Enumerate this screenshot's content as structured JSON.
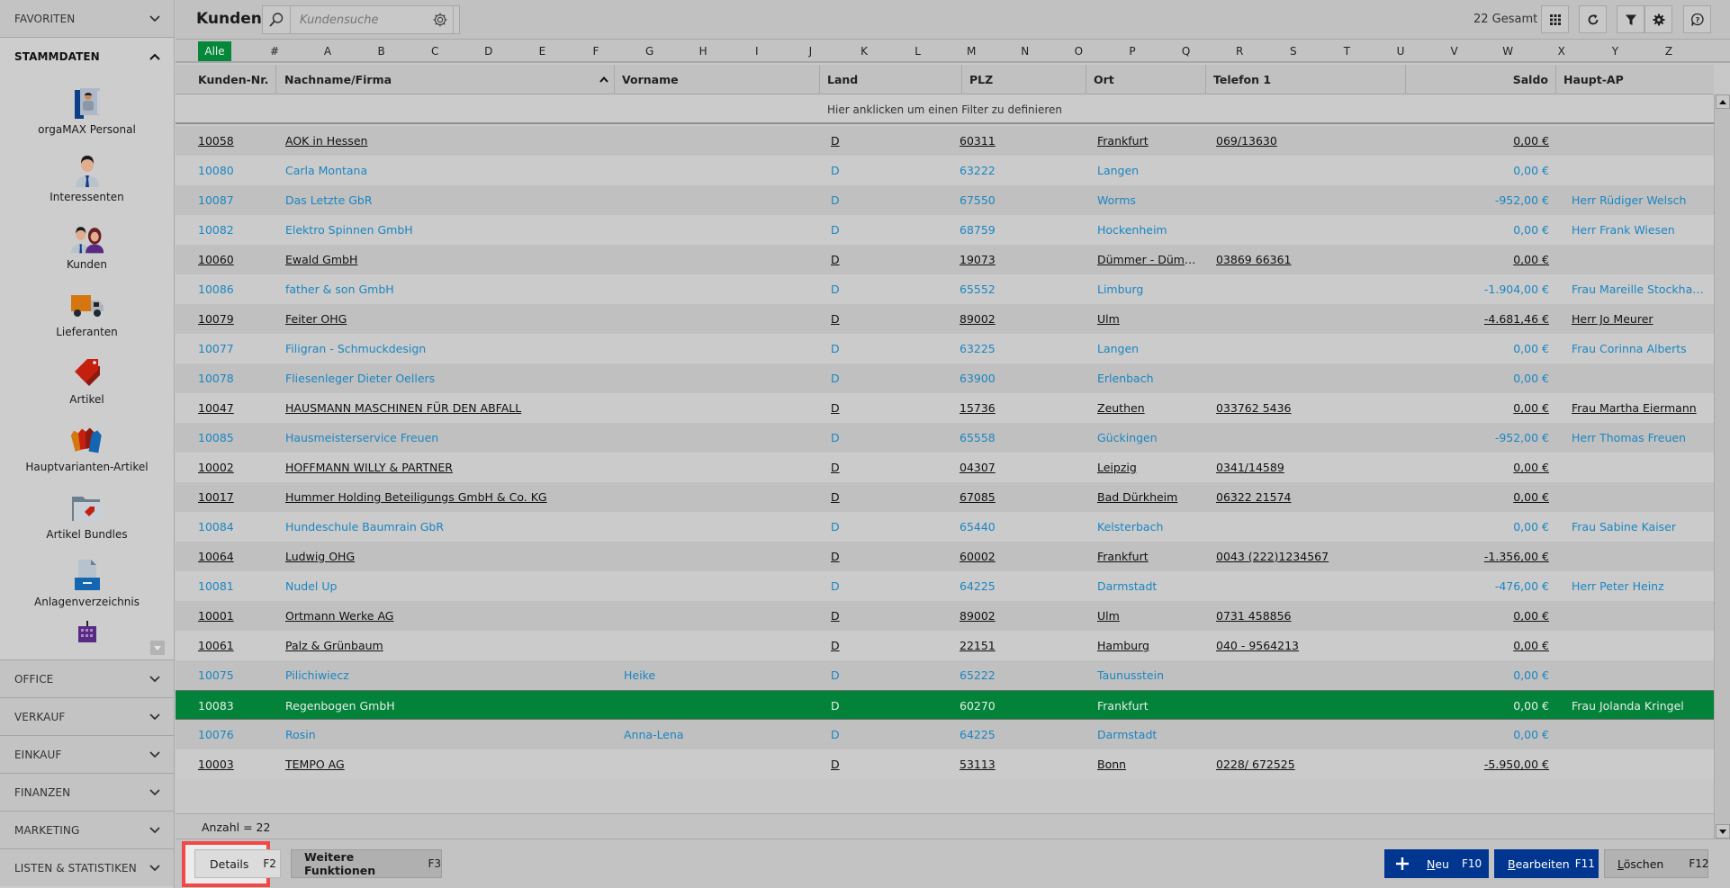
{
  "sidebar": {
    "sections_top": [
      {
        "label": "FAVORITEN",
        "state": "collapsed"
      },
      {
        "label": "STAMMDATEN",
        "state": "expanded"
      }
    ],
    "stammdaten_items": [
      {
        "label": "orgaMAX Personal",
        "icon": "personnel-card-icon"
      },
      {
        "label": "Interessenten",
        "icon": "person-icon"
      },
      {
        "label": "Kunden",
        "icon": "customers-icon"
      },
      {
        "label": "Lieferanten",
        "icon": "truck-icon"
      },
      {
        "label": "Artikel",
        "icon": "price-tag-icon"
      },
      {
        "label": "Hauptvarianten-Artikel",
        "icon": "multi-tag-icon"
      },
      {
        "label": "Artikel Bundles",
        "icon": "tag-folder-icon"
      },
      {
        "label": "Anlagenverzeichnis",
        "icon": "document-tray-icon"
      }
    ],
    "sections_bottom": [
      {
        "label": "OFFICE"
      },
      {
        "label": "VERKAUF"
      },
      {
        "label": "EINKAUF"
      },
      {
        "label": "FINANZEN"
      },
      {
        "label": "MARKETING"
      },
      {
        "label": "LISTEN & STATISTIKEN"
      }
    ]
  },
  "header": {
    "title": "Kunden",
    "search_placeholder": "Kundensuche",
    "total": "22 Gesamt"
  },
  "alphabet": [
    "Alle",
    "#",
    "A",
    "B",
    "C",
    "D",
    "E",
    "F",
    "G",
    "H",
    "I",
    "J",
    "K",
    "L",
    "M",
    "N",
    "O",
    "P",
    "Q",
    "R",
    "S",
    "T",
    "U",
    "V",
    "W",
    "X",
    "Y",
    "Z"
  ],
  "alphabet_active": "Alle",
  "columns": [
    "Kunden-Nr.",
    "Nachname/Firma",
    "Vorname",
    "Land",
    "PLZ",
    "Ort",
    "Telefon 1",
    "Saldo",
    "Haupt-AP"
  ],
  "sort_indicator": "^",
  "filter_hint": "Hier anklicken um einen Filter zu definieren",
  "rows": [
    {
      "nr": "10058",
      "name": "AOK in Hessen",
      "vorname": "",
      "land": "D",
      "plz": "60311",
      "ort": "Frankfurt",
      "tel": "069/13630",
      "saldo": "0,00 €",
      "ap": "",
      "style": "dark"
    },
    {
      "nr": "10080",
      "name": "Carla Montana",
      "vorname": "",
      "land": "D",
      "plz": "63222",
      "ort": "Langen",
      "tel": "",
      "saldo": "0,00 €",
      "ap": "",
      "style": "blue"
    },
    {
      "nr": "10087",
      "name": "Das Letzte GbR",
      "vorname": "",
      "land": "D",
      "plz": "67550",
      "ort": "Worms",
      "tel": "",
      "saldo": "-952,00 €",
      "ap": "Herr Rüdiger Welsch",
      "style": "blue"
    },
    {
      "nr": "10082",
      "name": "Elektro Spinnen GmbH",
      "vorname": "",
      "land": "D",
      "plz": "68759",
      "ort": "Hockenheim",
      "tel": "",
      "saldo": "0,00 €",
      "ap": "Herr Frank Wiesen",
      "style": "blue"
    },
    {
      "nr": "10060",
      "name": "Ewald GmbH",
      "vorname": "",
      "land": "D",
      "plz": "19073",
      "ort": "Dümmer - Dümm...",
      "tel": "03869 66361",
      "saldo": "0,00 €",
      "ap": "",
      "style": "dark"
    },
    {
      "nr": "10086",
      "name": "father & son GmbH",
      "vorname": "",
      "land": "D",
      "plz": "65552",
      "ort": "Limburg",
      "tel": "",
      "saldo": "-1.904,00 €",
      "ap": "Frau Mareille Stockhau...",
      "style": "blue"
    },
    {
      "nr": "10079",
      "name": "Feiter OHG",
      "vorname": "",
      "land": "D",
      "plz": "89002",
      "ort": "Ulm",
      "tel": "",
      "saldo": "-4.681,46 €",
      "ap": "Herr Jo Meurer",
      "style": "dark"
    },
    {
      "nr": "10077",
      "name": "Filigran - Schmuckdesign",
      "vorname": "",
      "land": "D",
      "plz": "63225",
      "ort": "Langen",
      "tel": "",
      "saldo": "0,00 €",
      "ap": "Frau Corinna Alberts",
      "style": "blue"
    },
    {
      "nr": "10078",
      "name": "Fliesenleger Dieter Oellers",
      "vorname": "",
      "land": "D",
      "plz": "63900",
      "ort": "Erlenbach",
      "tel": "",
      "saldo": "0,00 €",
      "ap": "",
      "style": "blue"
    },
    {
      "nr": "10047",
      "name": "HAUSMANN MASCHINEN FÜR DEN ABFALL",
      "vorname": "",
      "land": "D",
      "plz": "15736",
      "ort": "Zeuthen",
      "tel": "033762 5436",
      "saldo": "0,00 €",
      "ap": "Frau Martha Eiermann",
      "style": "dark"
    },
    {
      "nr": "10085",
      "name": "Hausmeisterservice Freuen",
      "vorname": "",
      "land": "D",
      "plz": "65558",
      "ort": "Gückingen",
      "tel": "",
      "saldo": "-952,00 €",
      "ap": "Herr Thomas Freuen",
      "style": "blue"
    },
    {
      "nr": "10002",
      "name": "HOFFMANN WILLY & PARTNER",
      "vorname": "",
      "land": "D",
      "plz": "04307",
      "ort": "Leipzig",
      "tel": "0341/14589",
      "saldo": "0,00 €",
      "ap": "",
      "style": "dark"
    },
    {
      "nr": "10017",
      "name": "Hummer Holding Beteiligungs GmbH & Co. KG",
      "vorname": "",
      "land": "D",
      "plz": "67085",
      "ort": "Bad Dürkheim",
      "tel": "06322 21574",
      "saldo": "0,00 €",
      "ap": "",
      "style": "dark"
    },
    {
      "nr": "10084",
      "name": "Hundeschule Baumrain GbR",
      "vorname": "",
      "land": "D",
      "plz": "65440",
      "ort": "Kelsterbach",
      "tel": "",
      "saldo": "0,00 €",
      "ap": "Frau Sabine Kaiser",
      "style": "blue"
    },
    {
      "nr": "10064",
      "name": "Ludwig OHG",
      "vorname": "",
      "land": "D",
      "plz": "60002",
      "ort": "Frankfurt",
      "tel": "0043 (222)1234567",
      "saldo": "-1.356,00 €",
      "ap": "",
      "style": "dark"
    },
    {
      "nr": "10081",
      "name": "Nudel Up",
      "vorname": "",
      "land": "D",
      "plz": "64225",
      "ort": "Darmstadt",
      "tel": "",
      "saldo": "-476,00 €",
      "ap": "Herr Peter Heinz",
      "style": "blue"
    },
    {
      "nr": "10001",
      "name": "Ortmann Werke AG",
      "vorname": "",
      "land": "D",
      "plz": "89002",
      "ort": "Ulm",
      "tel": "0731 458856",
      "saldo": "0,00 €",
      "ap": "",
      "style": "dark"
    },
    {
      "nr": "10061",
      "name": "Palz & Grünbaum",
      "vorname": "",
      "land": "D",
      "plz": "22151",
      "ort": "Hamburg",
      "tel": "040 - 9564213",
      "saldo": "0,00 €",
      "ap": "",
      "style": "dark"
    },
    {
      "nr": "10075",
      "name": "Pilichiwiecz",
      "vorname": "Heike",
      "land": "D",
      "plz": "65222",
      "ort": "Taunusstein",
      "tel": "",
      "saldo": "0,00 €",
      "ap": "",
      "style": "blue"
    },
    {
      "nr": "10083",
      "name": "Regenbogen GmbH",
      "vorname": "",
      "land": "D",
      "plz": "60270",
      "ort": "Frankfurt",
      "tel": "",
      "saldo": "0,00 €",
      "ap": "Frau Jolanda Kringel",
      "style": "sel"
    },
    {
      "nr": "10076",
      "name": "Rosin",
      "vorname": "Anna-Lena",
      "land": "D",
      "plz": "64225",
      "ort": "Darmstadt",
      "tel": "",
      "saldo": "0,00 €",
      "ap": "",
      "style": "blue"
    },
    {
      "nr": "10003",
      "name": "TEMPO AG",
      "vorname": "",
      "land": "D",
      "plz": "53113",
      "ort": "Bonn",
      "tel": "0228/ 672525",
      "saldo": "-5.950,00 €",
      "ap": "",
      "style": "dark"
    }
  ],
  "count_label": "Anzahl = 22",
  "footer": {
    "details": {
      "label": "Details",
      "key": "F2"
    },
    "weitere": {
      "label": "Weitere Funktionen",
      "key": "F3"
    },
    "neu": {
      "mnemonic": "N",
      "rest": "eu",
      "key": "F10"
    },
    "bearbeiten": {
      "mnemonic": "B",
      "rest": "earbeiten",
      "key": "F11"
    },
    "loeschen": {
      "mnemonic": "L",
      "rest": "öschen",
      "key": "F12"
    }
  },
  "colors": {
    "selected_row": "#03823a",
    "link_blue": "#1a86c2",
    "primary_button": "#003690",
    "highlight_outline": "#f24848",
    "alpha_active": "#06883a"
  }
}
